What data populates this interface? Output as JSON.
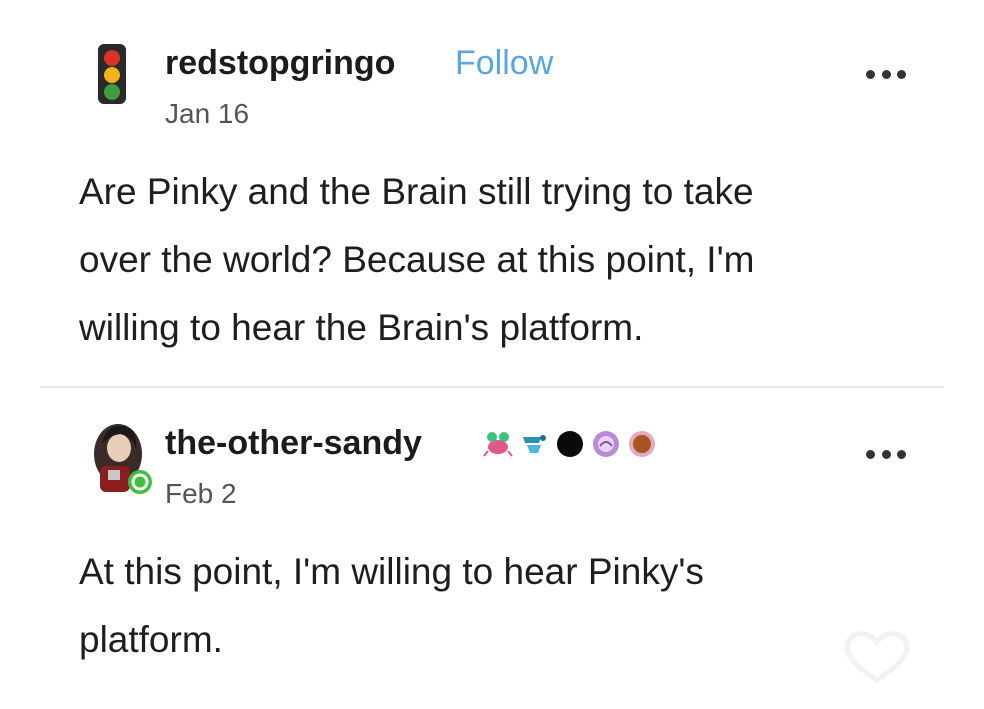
{
  "posts": [
    {
      "username": "redstopgringo",
      "follow_label": "Follow",
      "date": "Jan 16",
      "body_lines": [
        "Are Pinky and the Brain still trying to take",
        "over the world? Because at this point, I'm",
        "willing to hear the Brain's platform."
      ],
      "avatar_icon": "traffic-light-icon"
    },
    {
      "username": "the-other-sandy",
      "date": "Feb 2",
      "body_lines": [
        "At this point, I'm willing to hear Pinky's",
        "platform."
      ],
      "avatar_icon": "profile-photo",
      "badges": [
        "crab-badge-icon",
        "wave-badge-icon",
        "black-circle-badge-icon",
        "purple-badge-icon",
        "brown-badge-icon"
      ]
    }
  ],
  "colors": {
    "follow": "#5aa5e0",
    "text": "#1e1e1e",
    "meta": "#555555"
  }
}
